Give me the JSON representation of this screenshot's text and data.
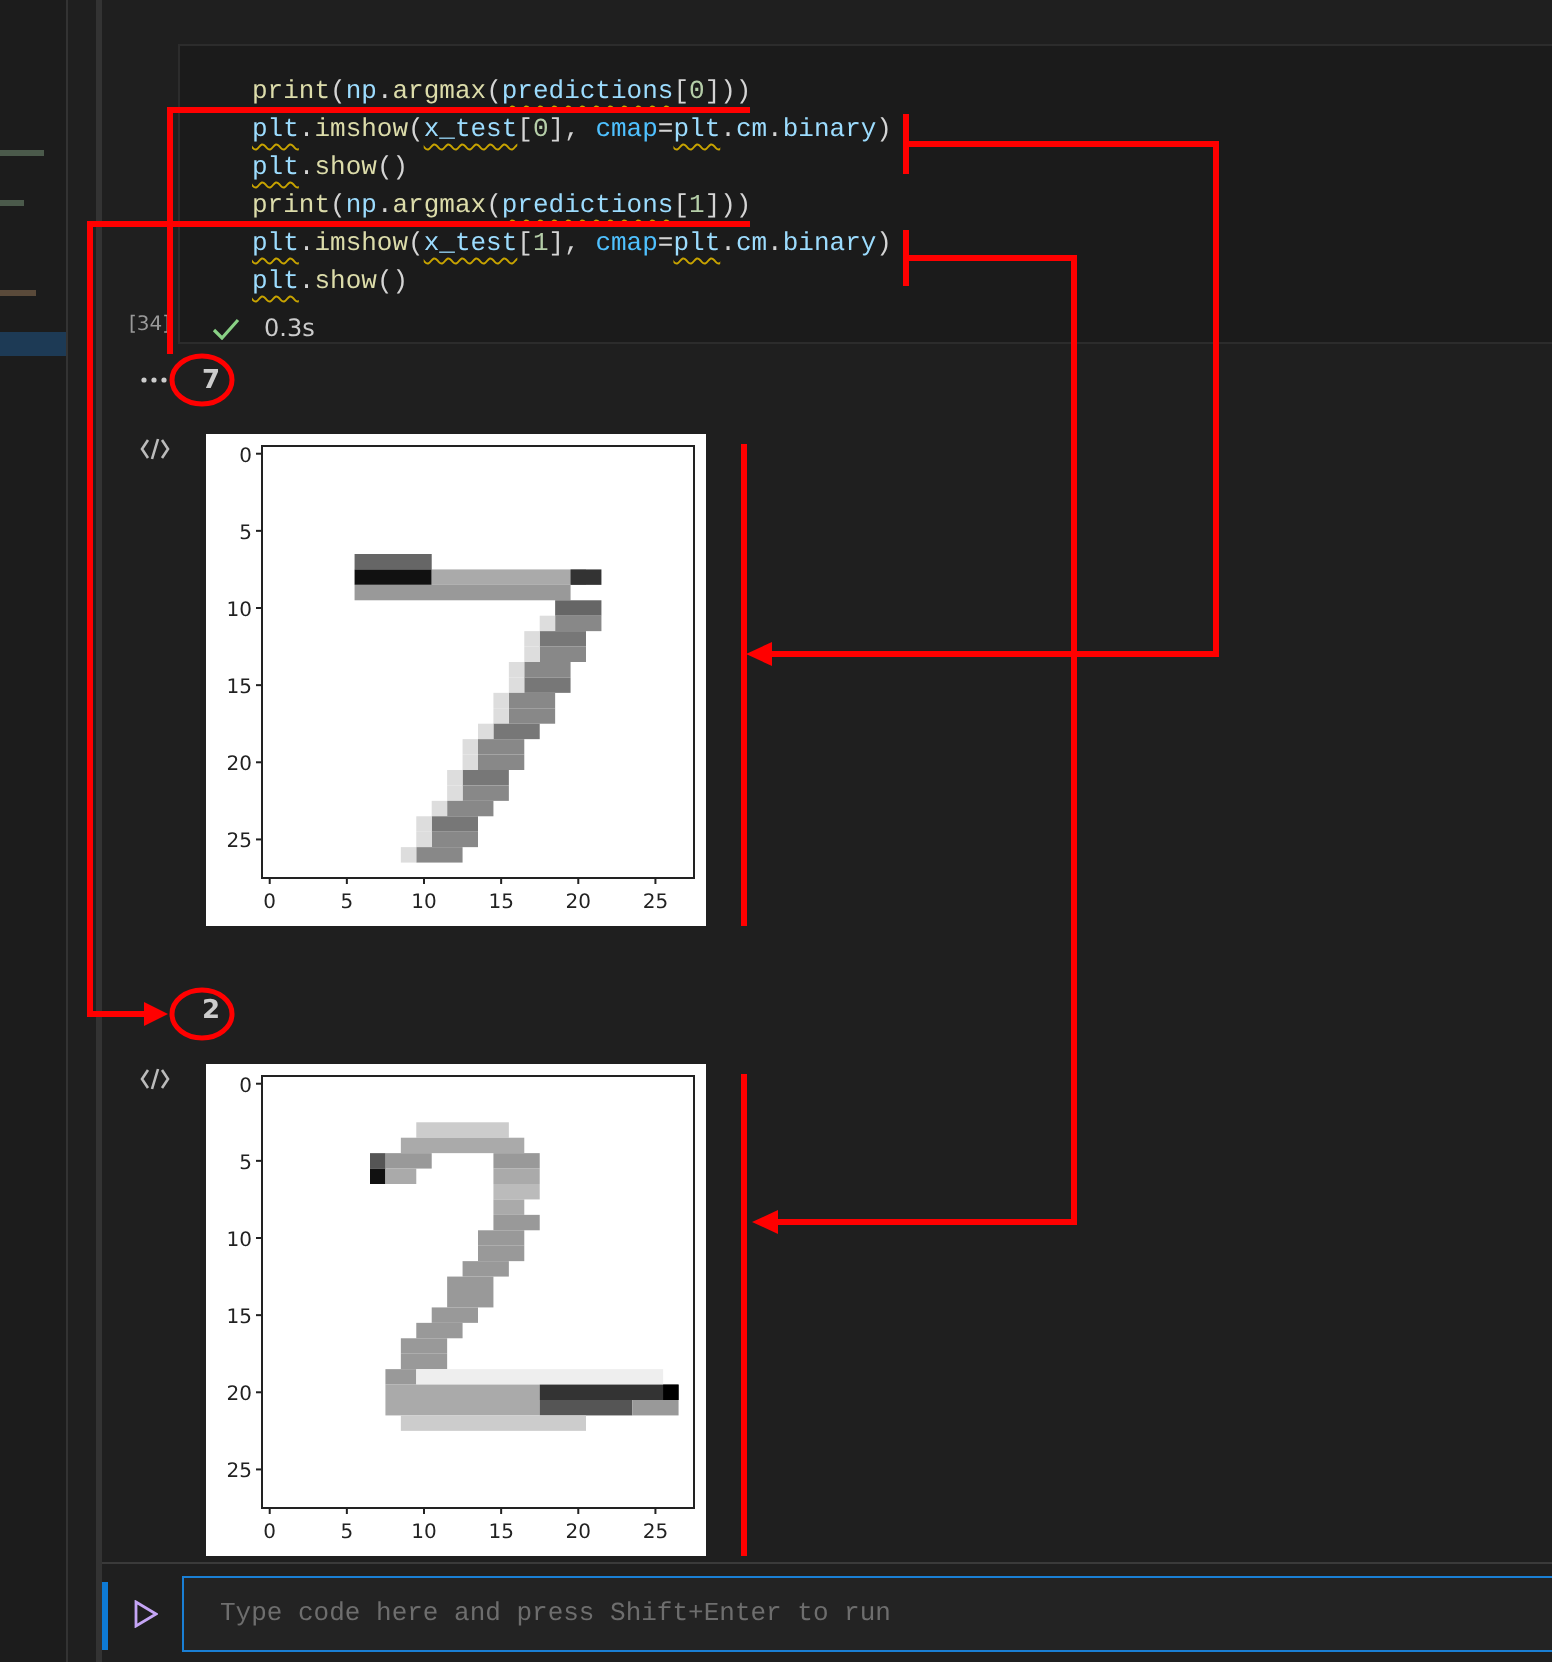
{
  "cell": {
    "execution_count": "[34]",
    "lines": [
      [
        {
          "kind": "fn",
          "text": "print"
        },
        {
          "kind": "plain",
          "text": "("
        },
        {
          "kind": "var",
          "text": "np"
        },
        {
          "kind": "plain",
          "text": "."
        },
        {
          "kind": "fn",
          "text": "argmax"
        },
        {
          "kind": "plain",
          "text": "("
        },
        {
          "kind": "var",
          "text": "predictions",
          "squiggle": true
        },
        {
          "kind": "plain",
          "text": "["
        },
        {
          "kind": "num",
          "text": "0"
        },
        {
          "kind": "plain",
          "text": "]))"
        }
      ],
      [
        {
          "kind": "var",
          "text": "plt",
          "squiggle": true
        },
        {
          "kind": "plain",
          "text": "."
        },
        {
          "kind": "fn",
          "text": "imshow"
        },
        {
          "kind": "plain",
          "text": "("
        },
        {
          "kind": "var",
          "text": "x_test",
          "squiggle": true
        },
        {
          "kind": "plain",
          "text": "["
        },
        {
          "kind": "num",
          "text": "0"
        },
        {
          "kind": "plain",
          "text": "], "
        },
        {
          "kind": "param",
          "text": "cmap"
        },
        {
          "kind": "plain",
          "text": "="
        },
        {
          "kind": "var",
          "text": "plt",
          "squiggle": true
        },
        {
          "kind": "plain",
          "text": "."
        },
        {
          "kind": "var",
          "text": "cm"
        },
        {
          "kind": "plain",
          "text": "."
        },
        {
          "kind": "var",
          "text": "binary"
        },
        {
          "kind": "plain",
          "text": ")"
        }
      ],
      [
        {
          "kind": "var",
          "text": "plt",
          "squiggle": true
        },
        {
          "kind": "plain",
          "text": "."
        },
        {
          "kind": "fn",
          "text": "show"
        },
        {
          "kind": "plain",
          "text": "()"
        }
      ],
      [
        {
          "kind": "fn",
          "text": "print"
        },
        {
          "kind": "plain",
          "text": "("
        },
        {
          "kind": "var",
          "text": "np"
        },
        {
          "kind": "plain",
          "text": "."
        },
        {
          "kind": "fn",
          "text": "argmax"
        },
        {
          "kind": "plain",
          "text": "("
        },
        {
          "kind": "var",
          "text": "predictions",
          "squiggle": true
        },
        {
          "kind": "plain",
          "text": "["
        },
        {
          "kind": "num",
          "text": "1"
        },
        {
          "kind": "plain",
          "text": "]))"
        }
      ],
      [
        {
          "kind": "var",
          "text": "plt",
          "squiggle": true
        },
        {
          "kind": "plain",
          "text": "."
        },
        {
          "kind": "fn",
          "text": "imshow"
        },
        {
          "kind": "plain",
          "text": "("
        },
        {
          "kind": "var",
          "text": "x_test",
          "squiggle": true
        },
        {
          "kind": "plain",
          "text": "["
        },
        {
          "kind": "num",
          "text": "1"
        },
        {
          "kind": "plain",
          "text": "], "
        },
        {
          "kind": "param",
          "text": "cmap"
        },
        {
          "kind": "plain",
          "text": "="
        },
        {
          "kind": "var",
          "text": "plt",
          "squiggle": true
        },
        {
          "kind": "plain",
          "text": "."
        },
        {
          "kind": "var",
          "text": "cm"
        },
        {
          "kind": "plain",
          "text": "."
        },
        {
          "kind": "var",
          "text": "binary"
        },
        {
          "kind": "plain",
          "text": ")"
        }
      ],
      [
        {
          "kind": "var",
          "text": "plt",
          "squiggle": true
        },
        {
          "kind": "plain",
          "text": "."
        },
        {
          "kind": "fn",
          "text": "show"
        },
        {
          "kind": "plain",
          "text": "()"
        }
      ]
    ],
    "duration": "0.3s"
  },
  "outputs": [
    {
      "kind": "text",
      "text": "7"
    },
    {
      "kind": "image",
      "xticks": [
        "0",
        "5",
        "10",
        "15",
        "20",
        "25"
      ],
      "yticks": [
        "0",
        "5",
        "10",
        "15",
        "20",
        "25"
      ]
    },
    {
      "kind": "text",
      "text": "2"
    },
    {
      "kind": "image",
      "xticks": [
        "0",
        "5",
        "10",
        "15",
        "20",
        "25"
      ],
      "yticks": [
        "0",
        "5",
        "10",
        "15",
        "20",
        "25"
      ]
    }
  ],
  "input": {
    "placeholder": "Type code here and press Shift+Enter to run"
  }
}
